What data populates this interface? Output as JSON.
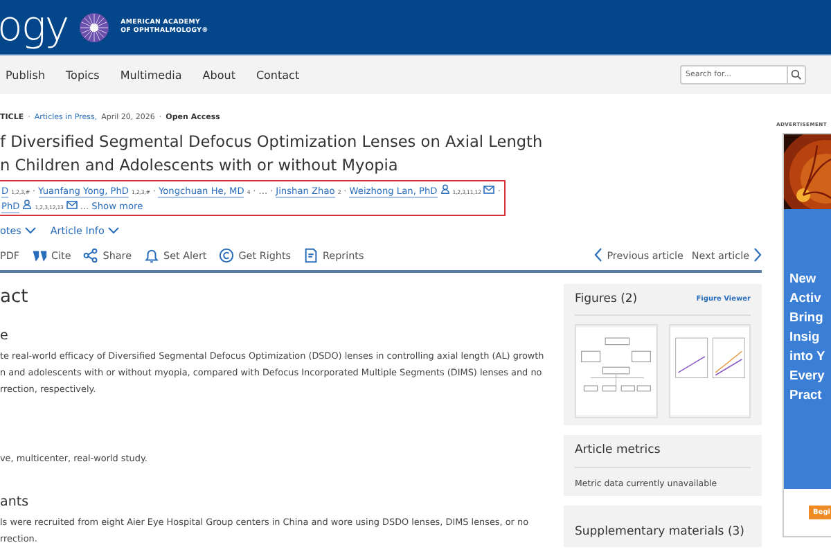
{
  "header": {
    "logo": "ogy",
    "society_lines": [
      "AMERICAN ACADEMY",
      "OF OPHTHALMOLOGY®"
    ]
  },
  "nav": {
    "items": [
      "Publish",
      "Topics",
      "Multimedia",
      "About",
      "Contact"
    ],
    "search": {
      "placeholder": "Search for..."
    }
  },
  "article": {
    "meta": [
      {
        "kind": "type",
        "text": "TICLE"
      },
      {
        "kind": "sep",
        "text": "·"
      },
      {
        "kind": "link",
        "text": "Articles in Press,"
      },
      {
        "kind": "date",
        "text": "April 20, 2026"
      },
      {
        "kind": "sep",
        "text": "·"
      },
      {
        "kind": "access",
        "text": "Open Access"
      }
    ],
    "title_lines": [
      "f Diversified Segmental Defocus Optimization Lenses on Axial Length",
      "n Children and Adolescents with or without Myopia"
    ],
    "author_lines": [
      [
        {
          "kind": "author",
          "name": "D",
          "sup": "1,2,3,#",
          "corresponding": false
        },
        {
          "kind": "sep",
          "text": "·"
        },
        {
          "kind": "author",
          "name": "Yuanfang Yong, PhD",
          "sup": "1,2,3,#",
          "corresponding": false
        },
        {
          "kind": "sep",
          "text": "·"
        },
        {
          "kind": "author",
          "name": "Yongchuan He, MD",
          "sup": "4",
          "corresponding": false
        },
        {
          "kind": "sep",
          "text": "·"
        },
        {
          "kind": "sep",
          "text": "..."
        },
        {
          "kind": "sep",
          "text": "·"
        },
        {
          "kind": "author",
          "name": "Jinshan Zhao",
          "sup": "2",
          "corresponding": false
        },
        {
          "kind": "sep",
          "text": "·"
        },
        {
          "kind": "author",
          "name": "Weizhong Lan, PhD",
          "sup": "1,2,3,11,12",
          "corresponding": true
        },
        {
          "kind": "sep",
          "text": "·"
        }
      ],
      [
        {
          "kind": "author",
          "name": "PhD",
          "sup": "1,2,3,12,13",
          "corresponding": true
        },
        {
          "kind": "sep",
          "text": "..."
        },
        {
          "kind": "more",
          "text": "Show more"
        }
      ]
    ],
    "dropdowns": [
      "otes",
      "Article Info"
    ],
    "actions": [
      {
        "kind": "none",
        "label": "PDF"
      },
      {
        "kind": "quote",
        "label": "Cite"
      },
      {
        "kind": "share",
        "label": "Share"
      },
      {
        "kind": "bell",
        "label": "Set Alert"
      },
      {
        "kind": "copyright",
        "label": "Get Rights"
      },
      {
        "kind": "doc",
        "label": "Reprints"
      }
    ],
    "pager": {
      "previous": "Previous article",
      "next": "Next article"
    }
  },
  "abstract": {
    "heading": "act",
    "sections": [
      {
        "heading": "e",
        "lines": [
          "te real-world efficacy of Diversified Segmental Defocus Optimization (DSDO) lenses in controlling axial length (AL) growth",
          "n and adolescents with or without myopia, compared with Defocus Incorporated Multiple Segments (DIMS) lenses and no",
          "rrection, respectively."
        ]
      },
      {
        "lines": [
          "ve, multicenter, real-world study."
        ]
      },
      {
        "heading": "ants",
        "lines": [
          "ls were recruited from eight Aier Eye Hospital Group centers in China and wore using DSDO lenses, DIMS lenses, or no",
          "rrection."
        ]
      }
    ]
  },
  "panels": {
    "figures": {
      "title": "Figures (2)",
      "link": "Figure Viewer"
    },
    "metrics": {
      "title": "Article metrics",
      "text": "Metric data currently unavailable"
    },
    "supplementary": {
      "title": "Supplementary materials (3)"
    }
  },
  "ad": {
    "label": "ADVERTISEMENT",
    "headline_lines": [
      "New",
      "Activ",
      "Bring",
      "Insig",
      "into Y",
      "Every",
      "Pract"
    ],
    "button": "Begi"
  }
}
